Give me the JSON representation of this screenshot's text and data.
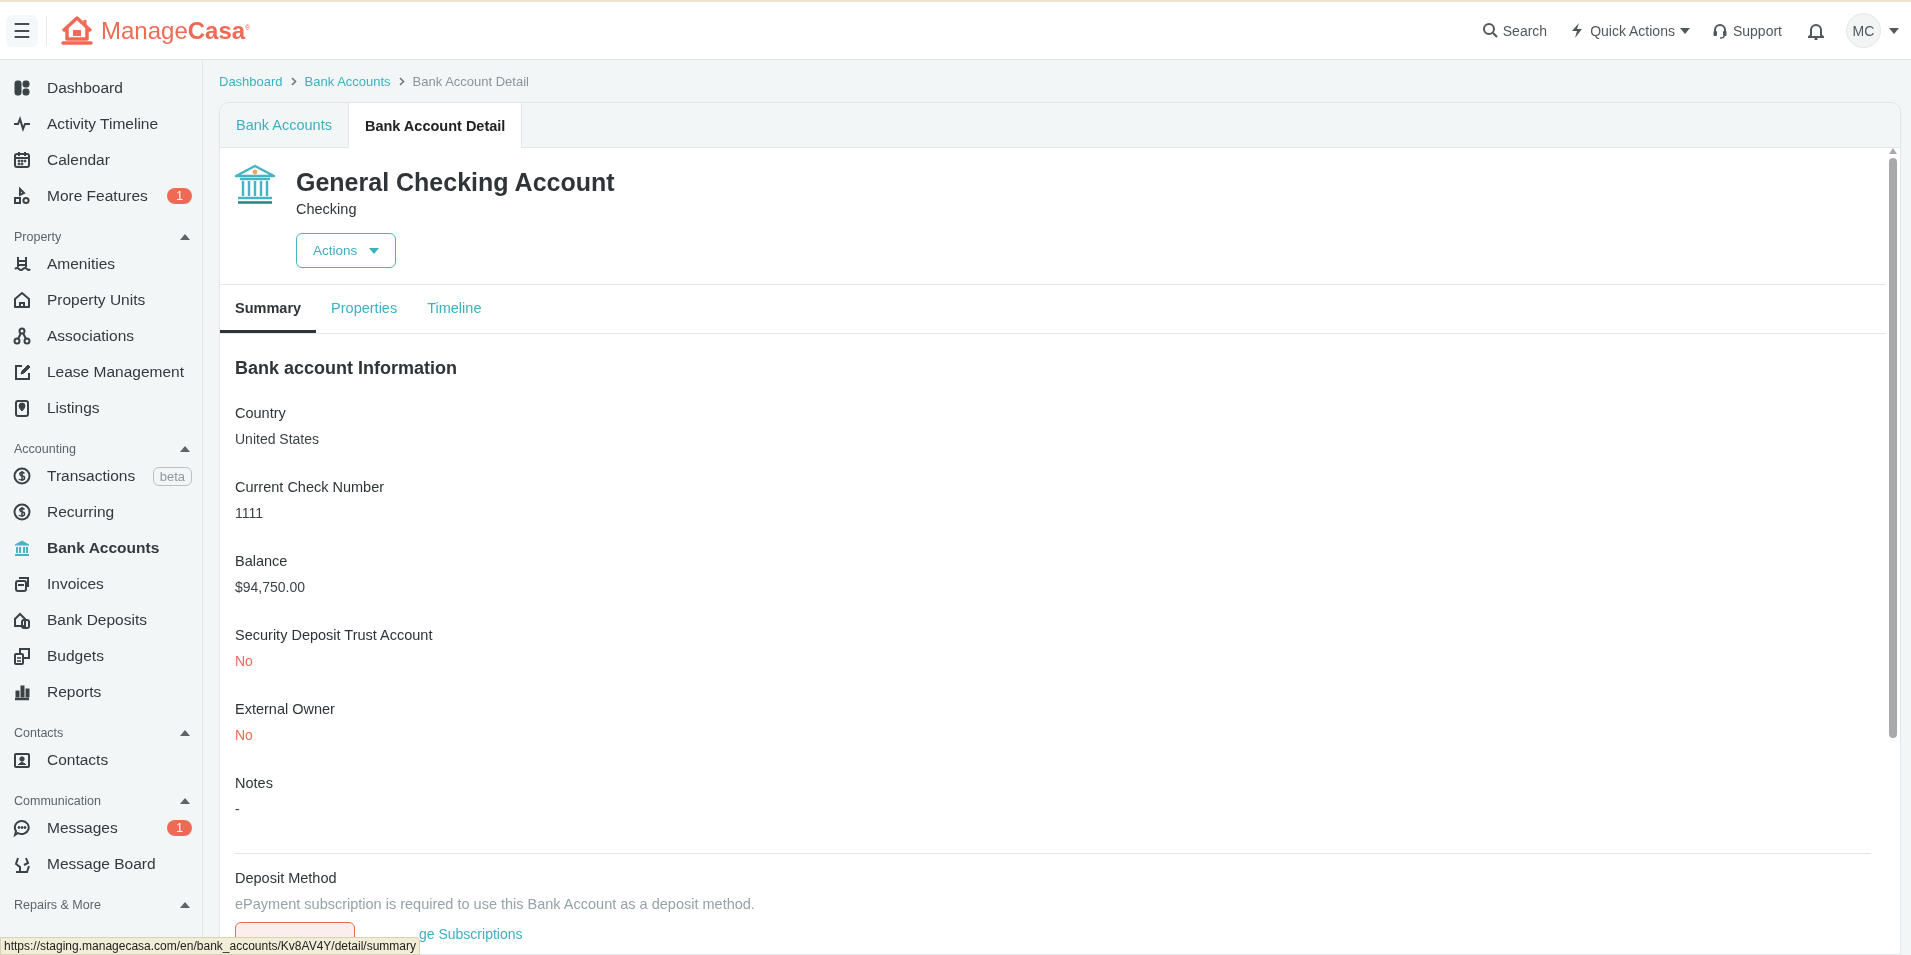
{
  "topbar": {
    "menu_button": "☰",
    "logo": "Manage**Casa**$^{®}$",
    "actions": [
      {
        "label": "Search",
        "has_menu": false
      },
      {
        "label": "Quick Actions",
        "has_menu": true
      },
      {
        "label": "Support",
        "has_menu": false
      }
    ],
    "avatar": "MC"
  },
  "sidebar": {
    "top_items": [
      {
        "label": "Dashboard",
        "selected": false
      },
      {
        "label": "Activity Timeline",
        "selected": false
      },
      {
        "label": "Calendar",
        "selected": false
      },
      {
        "label": "More Features",
        "selected": false,
        "badge": "1"
      }
    ],
    "sections": [
      {
        "title": "Property",
        "expanded": true,
        "items": [
          {
            "label": "Amenities",
            "selected": false
          },
          {
            "label": "Property Units",
            "selected": false
          },
          {
            "label": "Associations",
            "selected": false
          },
          {
            "label": "Lease Management",
            "selected": false
          },
          {
            "label": "Listings",
            "selected": false
          }
        ]
      },
      {
        "title": "Accounting",
        "expanded": true,
        "items": [
          {
            "label": "Transactions",
            "selected": false,
            "tag": "beta"
          },
          {
            "label": "Recurring",
            "selected": false
          },
          {
            "label": "Bank Accounts",
            "selected": true
          },
          {
            "label": "Invoices",
            "selected": false
          },
          {
            "label": "Bank Deposits",
            "selected": false
          },
          {
            "label": "Budgets",
            "selected": false
          },
          {
            "label": "Reports",
            "selected": false
          }
        ]
      },
      {
        "title": "Contacts",
        "expanded": true,
        "items": [
          {
            "label": "Contacts",
            "selected": false
          }
        ]
      },
      {
        "title": "Communication",
        "expanded": true,
        "items": [
          {
            "label": "Messages",
            "selected": false,
            "badge": "1"
          },
          {
            "label": "Message Board",
            "selected": false
          }
        ]
      },
      {
        "title": "Repairs & More",
        "expanded": true
      }
    ]
  },
  "breadcrumb": [
    {
      "label": "Dashboard",
      "current": false
    },
    {
      "label": "Bank Accounts",
      "current": false
    },
    {
      "label": "Bank Account Detail",
      "current": true
    }
  ],
  "tabs": [
    {
      "label": "Bank Accounts",
      "selected": false
    },
    {
      "label": "Bank Account Detail",
      "selected": true
    }
  ],
  "account": {
    "name": "General Checking Account",
    "type": "Checking",
    "actions_button": "Actions"
  },
  "subtabs": [
    {
      "label": "Summary",
      "selected": true
    },
    {
      "label": "Properties",
      "selected": false
    },
    {
      "label": "Timeline",
      "selected": false
    }
  ],
  "section_title": "Bank account Information",
  "fields": [
    {
      "label": "Country",
      "value": "United States",
      "kind": "plain"
    },
    {
      "label": "Current Check Number",
      "value": "1111",
      "kind": "plain"
    },
    {
      "label": "Balance",
      "value": "$94,750.00",
      "kind": "plain"
    },
    {
      "label": "Security Deposit Trust Account",
      "value": "No",
      "kind": "negative"
    },
    {
      "label": "External Owner",
      "value": "No",
      "kind": "negative"
    },
    {
      "label": "Notes",
      "value": "-",
      "kind": "plain"
    }
  ],
  "deposit": {
    "label": "Deposit Method",
    "note": "ePayment subscription is required to use this Bank Account as a deposit method.",
    "link": "ge Subscriptions"
  },
  "status_url": "https://staging.managecasa.com/en/bank_accounts/Kv8AV4Y/detail/summary"
}
